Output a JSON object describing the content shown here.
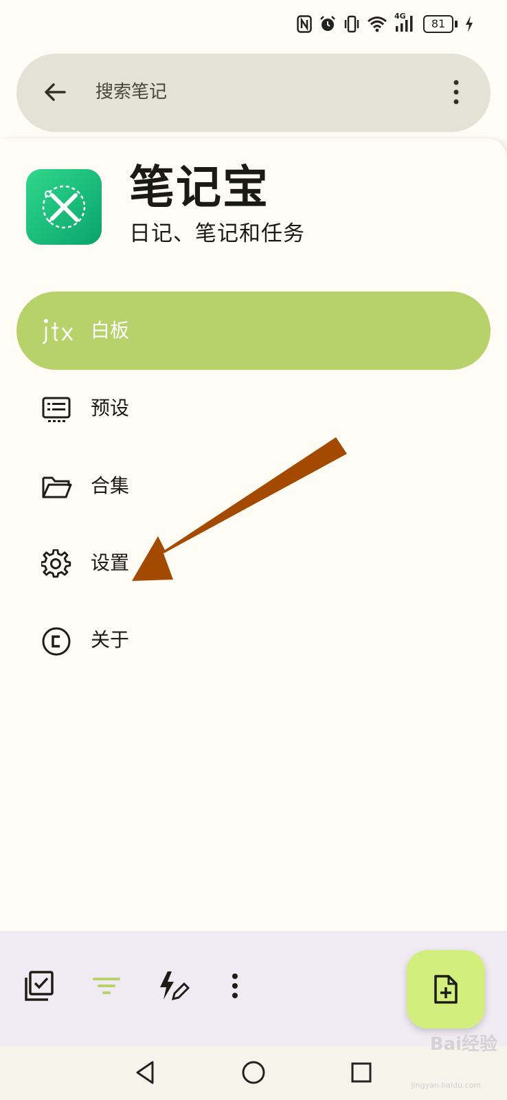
{
  "status_bar": {
    "network_type": "4G",
    "battery_level": "81",
    "icons": [
      "nfc-icon",
      "alarm-icon",
      "vibrate-icon",
      "wifi-icon",
      "signal-icon",
      "battery-icon",
      "charging-icon"
    ]
  },
  "search": {
    "placeholder": "搜索笔记"
  },
  "app": {
    "title": "笔记宝",
    "subtitle": "日记、笔记和任务"
  },
  "nav": {
    "items": [
      {
        "label": "白板",
        "icon": "jtx-logo-icon",
        "active": true
      },
      {
        "label": "预设",
        "icon": "presets-icon",
        "active": false
      },
      {
        "label": "合集",
        "icon": "folder-icon",
        "active": false
      },
      {
        "label": "设置",
        "icon": "gear-icon",
        "active": false
      },
      {
        "label": "关于",
        "icon": "copyright-icon",
        "active": false
      }
    ]
  },
  "bottom_bar": {
    "icons": [
      "checklist-icon",
      "filter-icon",
      "quick-add-icon",
      "more-vert-icon"
    ],
    "fab_icon": "add-note-icon"
  },
  "system_nav": {
    "icons": [
      "back-triangle-icon",
      "home-circle-icon",
      "recents-square-icon"
    ]
  },
  "watermark": {
    "text": "Bai经验",
    "sub": "jingyan.baidu.com"
  },
  "colors": {
    "active_nav": "#b8d26b",
    "annotation_arrow": "#a34a00",
    "fab": "#d2ef7e",
    "app_logo": "#0fb87a"
  }
}
